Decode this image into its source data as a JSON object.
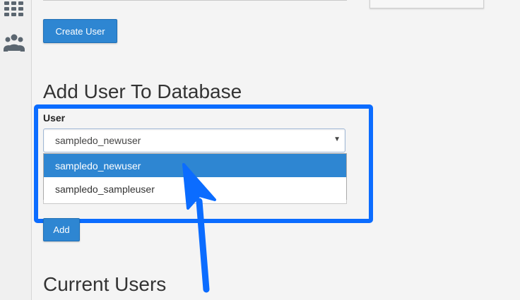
{
  "sidebar": {
    "icons": [
      "grid-icon",
      "users-icon"
    ]
  },
  "create_section": {
    "create_button_label": "Create User"
  },
  "add_user_section": {
    "heading": "Add User To Database",
    "user_label": "User",
    "selected_user": "sampledo_newuser",
    "options": [
      "sampledo_newuser",
      "sampledo_sampleuser"
    ],
    "add_button_label": "Add"
  },
  "current_users_section": {
    "heading": "Current Users"
  },
  "colors": {
    "accent_blue": "#2e86d2",
    "highlight_blue": "#0b6cff"
  }
}
